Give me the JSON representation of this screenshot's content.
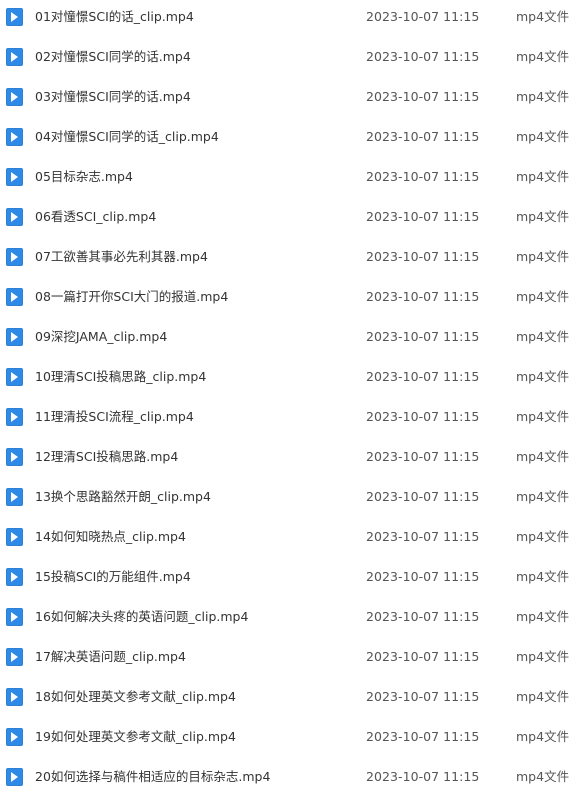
{
  "accent": "#2f8ae5",
  "files": [
    {
      "name": "01对憧憬SCI的话_clip.mp4",
      "date": "2023-10-07 11:15",
      "type": "mp4文件",
      "icon": "video-file-icon"
    },
    {
      "name": "02对憧憬SCI同学的话.mp4",
      "date": "2023-10-07 11:15",
      "type": "mp4文件",
      "icon": "video-file-icon"
    },
    {
      "name": "03对憧憬SCI同学的话.mp4",
      "date": "2023-10-07 11:15",
      "type": "mp4文件",
      "icon": "video-file-icon"
    },
    {
      "name": "04对憧憬SCI同学的话_clip.mp4",
      "date": "2023-10-07 11:15",
      "type": "mp4文件",
      "icon": "video-file-icon"
    },
    {
      "name": "05目标杂志.mp4",
      "date": "2023-10-07 11:15",
      "type": "mp4文件",
      "icon": "video-file-icon"
    },
    {
      "name": "06看透SCI_clip.mp4",
      "date": "2023-10-07 11:15",
      "type": "mp4文件",
      "icon": "video-file-icon"
    },
    {
      "name": "07工欲善其事必先利其器.mp4",
      "date": "2023-10-07 11:15",
      "type": "mp4文件",
      "icon": "video-file-icon"
    },
    {
      "name": "08一篇打开你SCI大门的报道.mp4",
      "date": "2023-10-07 11:15",
      "type": "mp4文件",
      "icon": "video-file-icon"
    },
    {
      "name": "09深挖JAMA_clip.mp4",
      "date": "2023-10-07 11:15",
      "type": "mp4文件",
      "icon": "video-file-icon"
    },
    {
      "name": "10理清SCI投稿思路_clip.mp4",
      "date": "2023-10-07 11:15",
      "type": "mp4文件",
      "icon": "video-file-icon"
    },
    {
      "name": "11理清投SCI流程_clip.mp4",
      "date": "2023-10-07 11:15",
      "type": "mp4文件",
      "icon": "video-file-icon"
    },
    {
      "name": "12理清SCI投稿思路.mp4",
      "date": "2023-10-07 11:15",
      "type": "mp4文件",
      "icon": "video-file-icon"
    },
    {
      "name": "13换个思路豁然开朗_clip.mp4",
      "date": "2023-10-07 11:15",
      "type": "mp4文件",
      "icon": "video-file-icon"
    },
    {
      "name": "14如何知晓热点_clip.mp4",
      "date": "2023-10-07 11:15",
      "type": "mp4文件",
      "icon": "video-file-icon"
    },
    {
      "name": "15投稿SCI的万能组件.mp4",
      "date": "2023-10-07 11:15",
      "type": "mp4文件",
      "icon": "video-file-icon"
    },
    {
      "name": "16如何解决头疼的英语问题_clip.mp4",
      "date": "2023-10-07 11:15",
      "type": "mp4文件",
      "icon": "video-file-icon"
    },
    {
      "name": "17解决英语问题_clip.mp4",
      "date": "2023-10-07 11:15",
      "type": "mp4文件",
      "icon": "video-file-icon"
    },
    {
      "name": "18如何处理英文参考文献_clip.mp4",
      "date": "2023-10-07 11:15",
      "type": "mp4文件",
      "icon": "video-file-icon"
    },
    {
      "name": "19如何处理英文参考文献_clip.mp4",
      "date": "2023-10-07 11:15",
      "type": "mp4文件",
      "icon": "video-file-icon"
    },
    {
      "name": "20如何选择与稿件相适应的目标杂志.mp4",
      "date": "2023-10-07 11:15",
      "type": "mp4文件",
      "icon": "video-file-icon"
    }
  ]
}
